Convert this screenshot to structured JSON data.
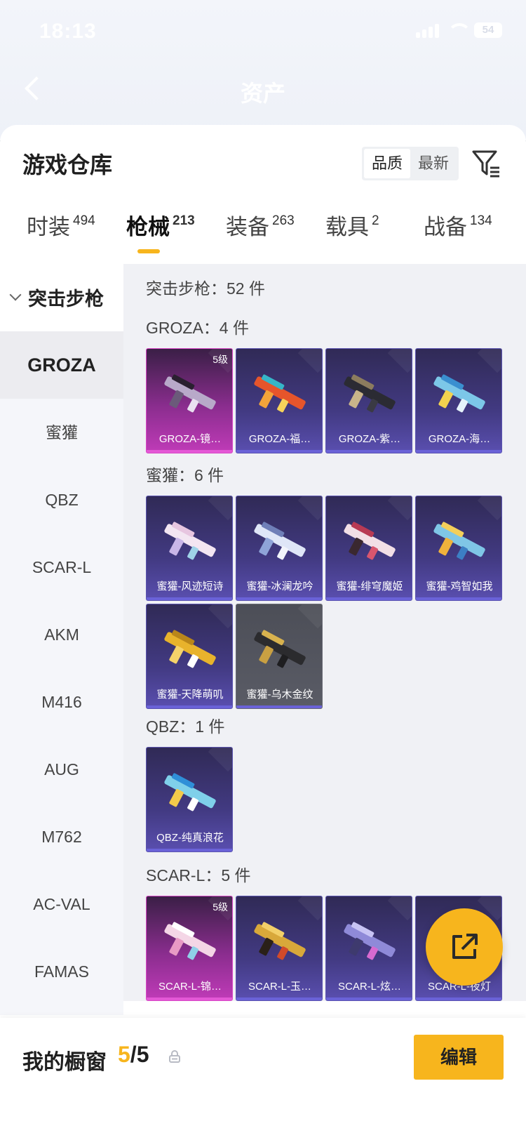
{
  "status": {
    "time": "18:13",
    "battery": "54"
  },
  "nav": {
    "title": "资产"
  },
  "sheet": {
    "title": "游戏仓库",
    "sort_options": [
      "品质",
      "最新"
    ],
    "active_sort": "品质"
  },
  "tabs": [
    {
      "label": "时装",
      "count": "494"
    },
    {
      "label": "枪械",
      "count": "213"
    },
    {
      "label": "装备",
      "count": "263"
    },
    {
      "label": "载具",
      "count": "2"
    },
    {
      "label": "战备",
      "count": "134"
    }
  ],
  "sidebar": {
    "group": "突击步枪",
    "items": [
      "GROZA",
      "蜜獾",
      "QBZ",
      "SCAR-L",
      "AKM",
      "M416",
      "AUG",
      "M762",
      "AC-VAL",
      "FAMAS"
    ],
    "active": "GROZA"
  },
  "content": {
    "category_total": "突击步枪：52 件",
    "sections": [
      {
        "label": "GROZA：4 件",
        "items": [
          {
            "name": "GROZA-镜…",
            "level": "5级",
            "rarity": "pink"
          },
          {
            "name": "GROZA-福…",
            "rarity": "purple"
          },
          {
            "name": "GROZA-紫…",
            "rarity": "purple"
          },
          {
            "name": "GROZA-海…",
            "rarity": "purple"
          }
        ]
      },
      {
        "label": "蜜獾：6 件",
        "items": [
          {
            "name": "蜜獾-风迹短诗",
            "rarity": "purple"
          },
          {
            "name": "蜜獾-冰澜龙吟",
            "rarity": "purple"
          },
          {
            "name": "蜜獾-绯穹魔姬",
            "rarity": "purple"
          },
          {
            "name": "蜜獾-鸡智如我",
            "rarity": "purple"
          },
          {
            "name": "蜜獾-天降萌叽",
            "rarity": "purple"
          },
          {
            "name": "蜜獾-乌木金纹",
            "rarity": "grey"
          }
        ]
      },
      {
        "label": "QBZ：1 件",
        "items": [
          {
            "name": "QBZ-纯真浪花",
            "rarity": "purple"
          }
        ]
      },
      {
        "label": "SCAR-L：5 件",
        "items": [
          {
            "name": "SCAR-L-锦…",
            "level": "5级",
            "rarity": "pink"
          },
          {
            "name": "SCAR-L-玉…",
            "rarity": "purple"
          },
          {
            "name": "SCAR-L-炫…",
            "rarity": "purple"
          },
          {
            "name": "SCAR-L-夜灯",
            "rarity": "purple"
          }
        ]
      }
    ]
  },
  "bottom": {
    "title": "我的橱窗",
    "current": "5",
    "separator": "/",
    "total": "5",
    "edit_label": "编辑"
  },
  "colors": {
    "accent": "#f7b51d",
    "epic": "#c03bb8",
    "rare": "#5a4fb0",
    "common": "#5a5c66"
  }
}
